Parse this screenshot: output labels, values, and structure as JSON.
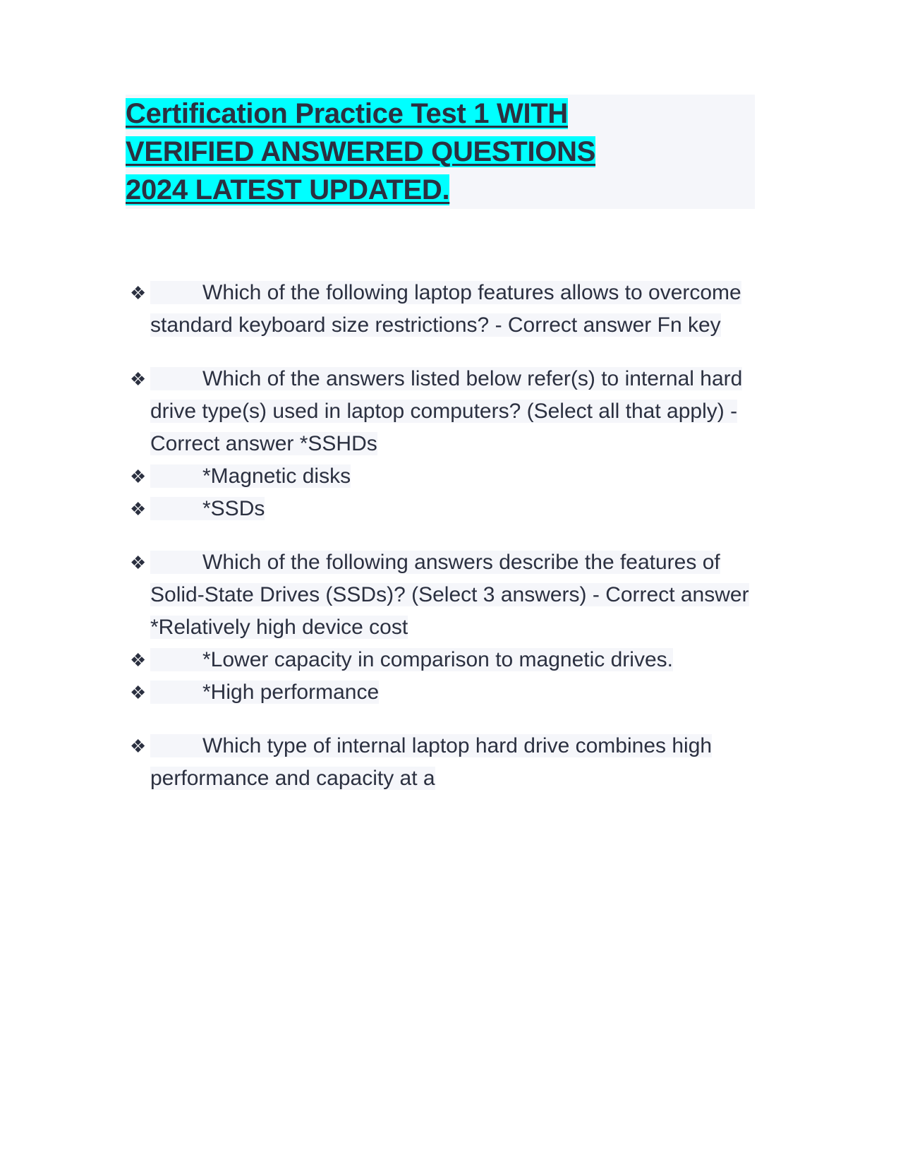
{
  "document": {
    "title_lines": [
      "Certification Practice Test 1  WITH ",
      "VERIFIED ANSWERED QUESTIONS ",
      "2024 LATEST UPDATED."
    ],
    "colors": {
      "page_background": "#ffffff",
      "text": "#2b3040",
      "title_highlight": "#00ffff",
      "body_highlight": "#f5f6fa"
    },
    "bullet_glyph": "❖",
    "groups": [
      {
        "items": [
          "Which of the following laptop features allows to overcome standard keyboard size restrictions? - Correct answer Fn key"
        ]
      },
      {
        "items": [
          "Which of the answers listed below refer(s) to internal hard drive type(s) used in laptop computers? (Select all that apply) - Correct answer *SSHDs",
          "*Magnetic disks",
          "*SSDs"
        ]
      },
      {
        "items": [
          "Which of the following answers describe the features of Solid-State Drives (SSDs)? (Select 3 answers) - Correct answer *Relatively high device cost",
          "*Lower capacity in comparison to magnetic drives.",
          "*High performance"
        ]
      },
      {
        "items": [
          "Which type of internal laptop hard drive combines high performance and capacity at a"
        ]
      }
    ]
  }
}
